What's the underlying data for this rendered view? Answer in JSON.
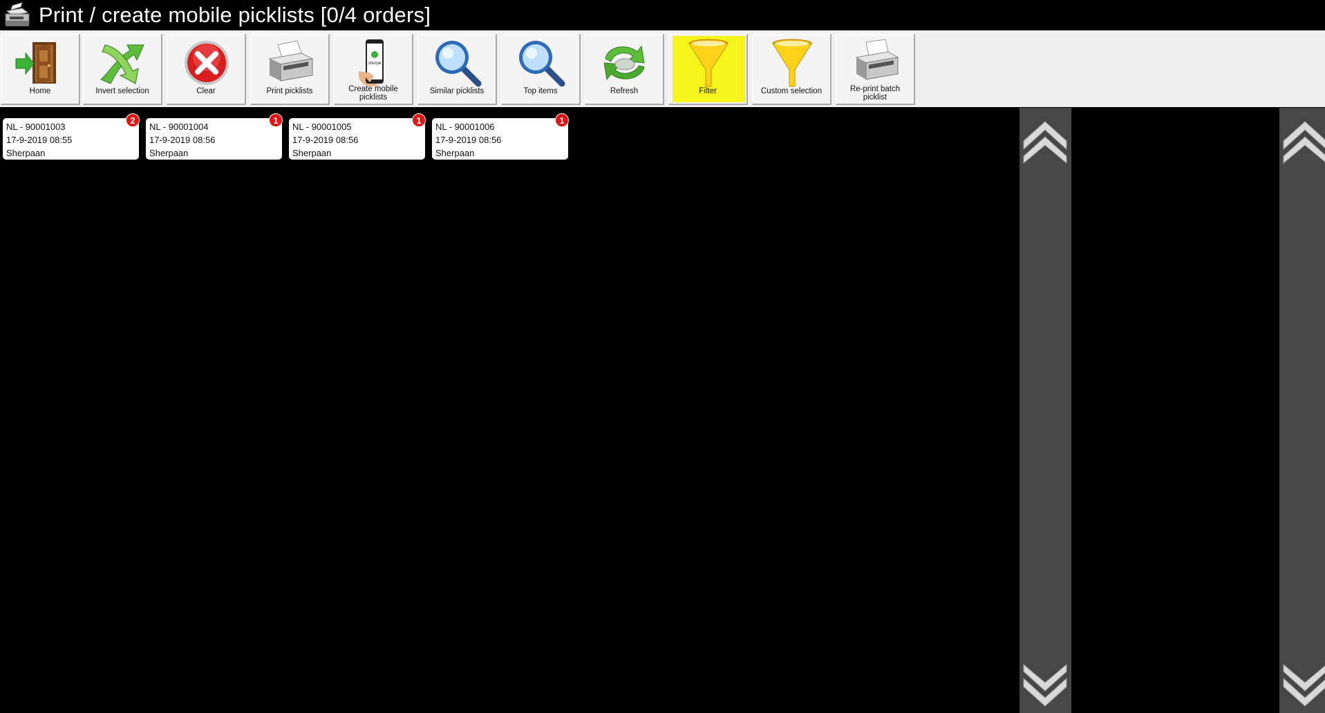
{
  "window": {
    "title": "Print / create mobile picklists [0/4 orders]",
    "icon": "printer-icon"
  },
  "toolbar": {
    "buttons": [
      {
        "label": "Home",
        "icon": "home-door-icon"
      },
      {
        "label": "Invert selection",
        "icon": "invert-arrows-icon"
      },
      {
        "label": "Clear",
        "icon": "clear-x-icon"
      },
      {
        "label": "Print picklists",
        "icon": "printer-icon"
      },
      {
        "label": "Create mobile picklists",
        "icon": "mobile-phone-icon"
      },
      {
        "label": "Similar picklists",
        "icon": "magnifier-icon"
      },
      {
        "label": "Top items",
        "icon": "magnifier-icon"
      },
      {
        "label": "Refresh",
        "icon": "refresh-arrows-icon"
      },
      {
        "label": "Filter",
        "icon": "funnel-icon"
      },
      {
        "label": "Custom selection",
        "icon": "funnel-icon"
      },
      {
        "label": "Re-print batch picklist",
        "icon": "printer-icon"
      }
    ],
    "highlight_color": "#f5f51c"
  },
  "phone_brand": "sherpa",
  "orders": [
    {
      "id": "NL - 90001003",
      "datetime": "17-9-2019 08:55",
      "customer": "Sherpaan",
      "badge": "2"
    },
    {
      "id": "NL - 90001004",
      "datetime": "17-9-2019 08:56",
      "customer": "Sherpaan",
      "badge": "1"
    },
    {
      "id": "NL - 90001005",
      "datetime": "17-9-2019 08:56",
      "customer": "Sherpaan",
      "badge": "1"
    },
    {
      "id": "NL - 90001006",
      "datetime": "17-9-2019 08:56",
      "customer": "Sherpaan",
      "badge": "1"
    }
  ],
  "colors": {
    "background": "#000000",
    "badge": "#e41313",
    "scrollbar": "#474747"
  }
}
